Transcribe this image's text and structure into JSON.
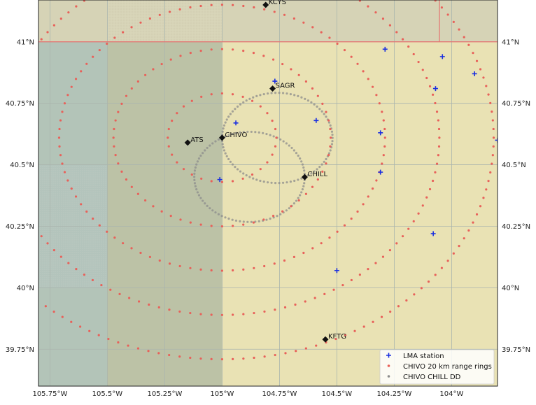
{
  "map": {
    "longitude_ticks": [
      "105.75°W",
      "105.5°W",
      "105.25°W",
      "105°W",
      "104.75°W",
      "104.5°W",
      "104.25°W",
      "104°W"
    ],
    "latitude_ticks": [
      "41°N",
      "40.75°N",
      "40.5°N",
      "40.25°N",
      "40°N",
      "39.75°N"
    ],
    "extent": {
      "lon_min": -105.8,
      "lon_max": -103.8,
      "lat_min": 39.6,
      "lat_max": 41.17
    },
    "colors": {
      "plains": "#e9e2b4",
      "west_region": "#bcc2a6",
      "northwest_tint": "#d6d3b6",
      "water_left": "#b0c4be",
      "grid": "#aab5ae",
      "state_border": "#e57370",
      "rings": "#e8615a",
      "dd_points": "#8c8c8c",
      "lma": "#1a2fe0",
      "sites": "#111111"
    }
  },
  "sites": [
    {
      "name": "KCYS",
      "lon": -104.81,
      "lat": 41.15
    },
    {
      "name": "SAGR",
      "lon": -104.78,
      "lat": 40.81
    },
    {
      "name": "ATS",
      "lon": -105.15,
      "lat": 40.59
    },
    {
      "name": "CHIVO",
      "lon": -105.0,
      "lat": 40.61
    },
    {
      "name": "CHILL",
      "lon": -104.64,
      "lat": 40.45
    },
    {
      "name": "KFTG",
      "lon": -104.55,
      "lat": 39.79
    }
  ],
  "lma_stations": [
    {
      "lon": -104.29,
      "lat": 40.97
    },
    {
      "lon": -104.04,
      "lat": 40.94
    },
    {
      "lon": -103.9,
      "lat": 40.87
    },
    {
      "lon": -104.07,
      "lat": 40.81
    },
    {
      "lon": -104.77,
      "lat": 40.84
    },
    {
      "lon": -104.59,
      "lat": 40.68
    },
    {
      "lon": -104.94,
      "lat": 40.67
    },
    {
      "lon": -104.31,
      "lat": 40.63
    },
    {
      "lon": -104.31,
      "lat": 40.47
    },
    {
      "lon": -105.01,
      "lat": 40.44
    },
    {
      "lon": -104.5,
      "lat": 40.07
    },
    {
      "lon": -104.08,
      "lat": 40.22
    },
    {
      "lon": -103.8,
      "lat": 40.6
    }
  ],
  "rings": {
    "center": {
      "lon": -105.0,
      "lat": 40.61
    },
    "radii_km": [
      20,
      40,
      60,
      80,
      100
    ]
  },
  "legend": {
    "lma_label": "LMA station",
    "rings_label": "CHIVO 20 km range rings",
    "dd_label": "CHIVO CHILL DD"
  }
}
